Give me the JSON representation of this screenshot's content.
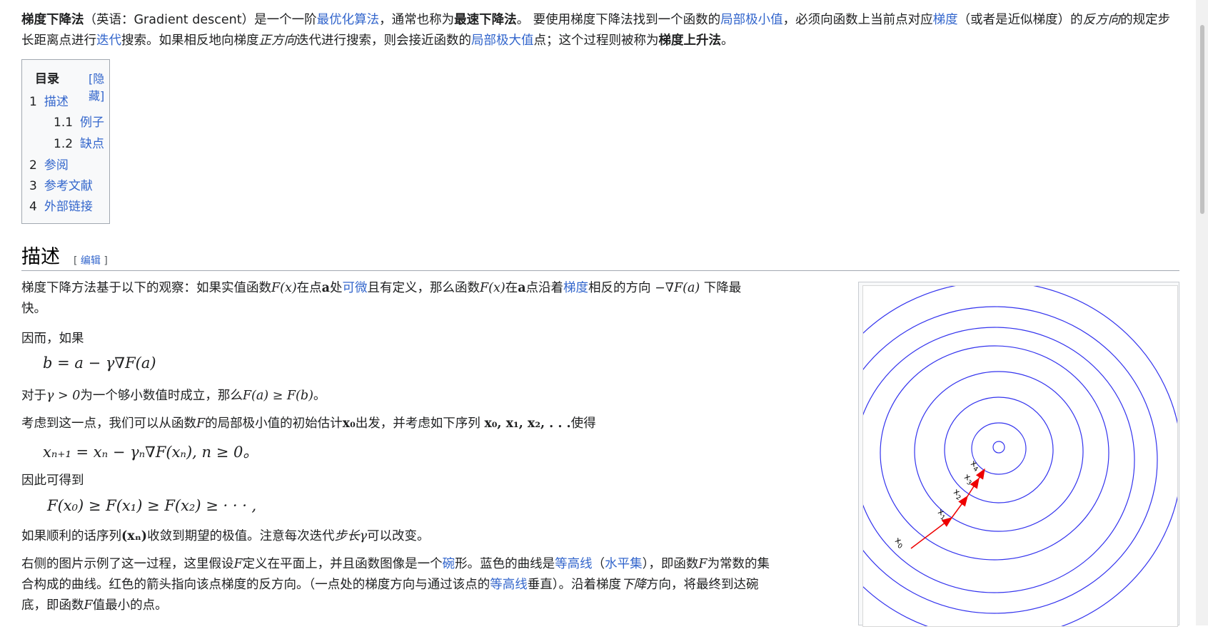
{
  "intro": {
    "bold1": "梯度下降法",
    "t1": "（英语：Gradient descent）是一个一阶",
    "link1": "最优化算法",
    "t2": "，通常也称为",
    "bold2": "最速下降法",
    "t3": "。 要使用梯度下降法找到一个函数的",
    "link2": "局部极小值",
    "t4": "，必须向函数上当前点对应",
    "link3": "梯度",
    "t5": "（或者是近似梯度）的",
    "it1": "反方向",
    "t6": "的规定步长距离点进行",
    "link4": "迭代",
    "t7": "搜索。如果相反地向梯度",
    "it2": "正方向",
    "t8": "迭代进行搜索，则会接近函数的",
    "link5": "局部极大值",
    "t9": "点；这个过程则被称为",
    "bold3": "梯度上升法",
    "t10": "。"
  },
  "toc": {
    "title": "目录",
    "hide": "[隐藏]",
    "items": [
      {
        "num": "1",
        "label": "描述"
      },
      {
        "num": "1.1",
        "label": "例子"
      },
      {
        "num": "1.2",
        "label": "缺点"
      },
      {
        "num": "2",
        "label": "参阅"
      },
      {
        "num": "3",
        "label": "参考文献"
      },
      {
        "num": "4",
        "label": "外部链接"
      }
    ]
  },
  "section": {
    "title": "描述",
    "edit_open": "[ ",
    "edit_label": "编辑",
    "edit_close": " ]"
  },
  "p1": {
    "a": "梯度下降方法基于以下的观察：如果实值函数",
    "m1": "F(x)",
    "b": "在点",
    "m2": "a",
    "c": "处",
    "link1": "可微",
    "d": "且有定义，那么函数",
    "m3": "F(x)",
    "e": "在",
    "m4": "a",
    "f": "点沿着",
    "link2": "梯度",
    "g": "相反的方向 ",
    "m5": "−∇F(a)",
    "h": " 下降最",
    "h2": "快。"
  },
  "p2": {
    "text": "因而，如果"
  },
  "f1": {
    "text": "b = a − γ∇F(a)"
  },
  "p3": {
    "a": "对于",
    "m1": "γ > 0",
    "b": "为一个够小数值时成立，那么",
    "m2": "F(a) ≥ F(b)",
    "c": "。"
  },
  "p4": {
    "a": "考虑到这一点，我们可以从函数",
    "m1": "F",
    "b": "的局部极小值的初始估计",
    "m2": "x₀",
    "c": "出发，并考虑如下序列 ",
    "m3": "x₀, x₁, x₂, . . .",
    "d": "使得"
  },
  "f2": {
    "text": "xₙ₊₁ = xₙ − γₙ∇F(xₙ), n ≥ 0。"
  },
  "p5": {
    "text": "因此可得到"
  },
  "f3": {
    "text": "F(x₀) ≥ F(x₁) ≥ F(x₂) ≥ · · · ,"
  },
  "p6": {
    "a": "如果顺利的话序列",
    "m1": "(xₙ)",
    "b": "收敛到期望的极值。注意每次迭代",
    "it": "步长",
    "m2": "γ",
    "c": "可以改变。"
  },
  "p7": {
    "a": "右侧的图片示例了这一过程，这里假设",
    "m1": "F",
    "b": "定义在平面上，并且函数图像是一个",
    "link1": "碗",
    "c": "形。蓝色的曲线是",
    "link2": "等高线",
    "d": "（",
    "link3": "水平集",
    "e": "），即函数",
    "m2": "F",
    "f": "为常数的集",
    "g": "合构成的曲线。红色的箭头指向该点梯度的反方向。（一点处的梯度方向与通过该点的",
    "link4": "等高线",
    "h": "垂直）。沿着梯度",
    "it": "下降",
    "i": "方向，将最终到达碗",
    "j": "底，即函数",
    "m3": "F",
    "k": "值最小的点。"
  },
  "figure": {
    "labels": [
      "x0",
      "x1",
      "x2",
      "x3",
      "x4"
    ],
    "contour_color": "#3333ee",
    "arrow_color": "#ee0000"
  }
}
